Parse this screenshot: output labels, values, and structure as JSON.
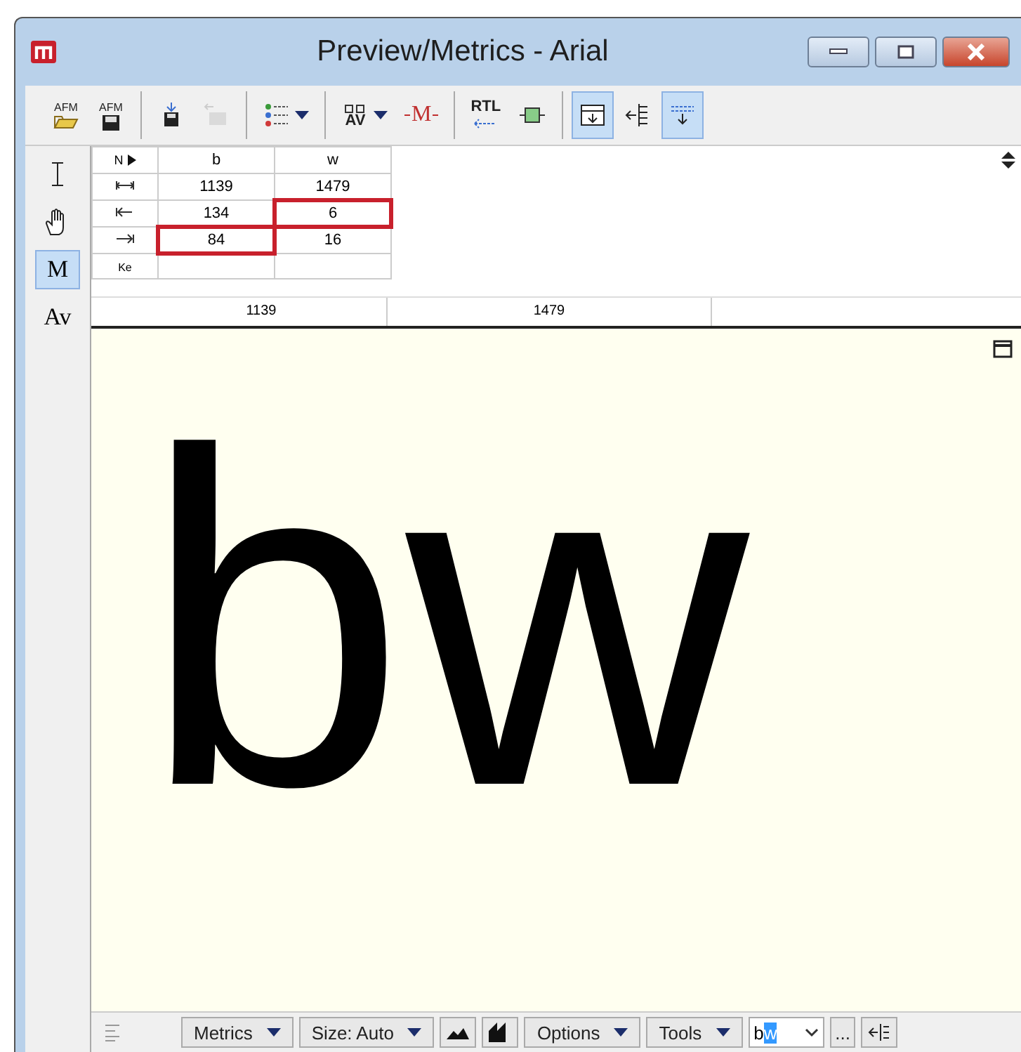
{
  "window": {
    "title": "Preview/Metrics - Arial"
  },
  "toolbar": {
    "groups": [
      [
        {
          "label": "AFM",
          "pressed": false,
          "disabled": false
        },
        {
          "label": "AFM",
          "pressed": false,
          "disabled": false
        }
      ],
      [
        {
          "pressed": false,
          "disabled": false
        },
        {
          "pressed": false,
          "disabled": true
        }
      ],
      [
        {
          "pressed": false,
          "disabled": false,
          "dropdown": true
        }
      ],
      [
        {
          "label": "AV",
          "pressed": false,
          "disabled": false,
          "dropdown": true
        },
        {
          "label": "M",
          "pressed": false,
          "disabled": false
        }
      ],
      [
        {
          "label": "RTL",
          "pressed": false,
          "disabled": false
        },
        {
          "pressed": false,
          "disabled": false
        }
      ],
      [
        {
          "pressed": true,
          "disabled": false
        },
        {
          "pressed": false,
          "disabled": false
        },
        {
          "pressed": true,
          "disabled": false
        }
      ]
    ]
  },
  "tools": [
    {
      "selected": false
    },
    {
      "selected": false
    },
    {
      "label": "M",
      "selected": true
    },
    {
      "label": "Av",
      "selected": false
    }
  ],
  "table": {
    "corner": "N",
    "columns": [
      "b",
      "w"
    ],
    "rows": [
      {
        "cells": [
          {
            "text": "1139",
            "highlighted": false
          },
          {
            "text": "1479",
            "highlighted": false
          }
        ]
      },
      {
        "cells": [
          {
            "text": "134",
            "highlighted": false
          },
          {
            "text": "6",
            "highlighted": true
          }
        ]
      },
      {
        "cells": [
          {
            "text": "84",
            "highlighted": true
          },
          {
            "text": "16",
            "highlighted": false
          }
        ]
      }
    ],
    "kerning_label": "Ke",
    "ruler": [
      "1139",
      "1479"
    ]
  },
  "preview": {
    "text": "bw"
  },
  "bottom_bar": [
    {
      "kind": "dropdown",
      "label": "Metrics"
    },
    {
      "kind": "dropdown",
      "label": "Size: Auto"
    },
    {
      "kind": "icon"
    },
    {
      "kind": "icon"
    },
    {
      "kind": "dropdown",
      "label": "Options"
    },
    {
      "kind": "dropdown",
      "label": "Tools"
    },
    {
      "kind": "field",
      "value": "b",
      "selection": "w"
    },
    {
      "kind": "button",
      "label": "..."
    },
    {
      "kind": "icon"
    }
  ]
}
